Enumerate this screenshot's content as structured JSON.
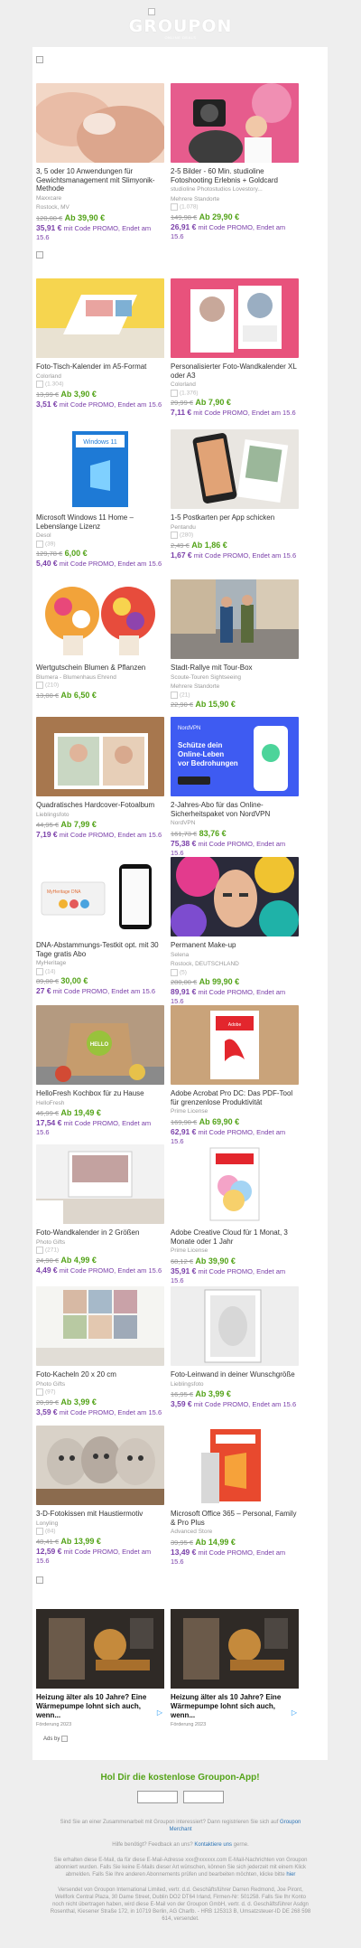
{
  "header": {
    "logo_text": "GROUPON",
    "logo_sub": "ONLINE DEALS"
  },
  "products": [
    {
      "title": "3, 5 oder 10 Anwendungen für Gewichtsmanagement mit Slimyonik-Methode",
      "meta1": "Maxxcare",
      "meta2": "Rostock, MV",
      "rating": "",
      "old": "120,00 €",
      "now": "Ab 39,90 €",
      "promo_price": "35,91 €",
      "promo_text": "mit Code PROMO, Endet am 15.6"
    },
    {
      "title": "2-5 Bilder - 60 Min. studioline Fotoshooting Erlebnis + Goldcard",
      "meta1": "studioline Photostudios Lovestory...",
      "meta2": "Mehrere Standorte",
      "rating": "(1.078)",
      "old": "149,98 €",
      "now": "Ab 29,90 €",
      "promo_price": "26,91 €",
      "promo_text": "mit Code PROMO, Endet am 15.6"
    },
    {
      "title": "Foto-Tisch-Kalender im A5-Format",
      "meta1": "Colorland",
      "meta2": "",
      "rating": "(1.304)",
      "old": "13,99 €",
      "now": "Ab 3,90 €",
      "promo_price": "3,51 €",
      "promo_text": "mit Code PROMO, Endet am 15.6"
    },
    {
      "title": "Personalisierter Foto-Wandkalender XL oder A3",
      "meta1": "Colorland",
      "meta2": "",
      "rating": "(1.376)",
      "old": "29,99 €",
      "now": "Ab 7,90 €",
      "promo_price": "7,11 €",
      "promo_text": "mit Code PROMO, Endet am 15.6"
    },
    {
      "title": "Microsoft Windows 11 Home – Lebenslange Lizenz",
      "meta1": "Desol",
      "meta2": "",
      "rating": "(39)",
      "old": "129,78 €",
      "now": "6,00 €",
      "promo_price": "5,40 €",
      "promo_text": "mit Code PROMO, Endet am 15.6"
    },
    {
      "title": "1-5 Postkarten per App schicken",
      "meta1": "Pentandu",
      "meta2": "",
      "rating": "(280)",
      "old": "2,49 €",
      "now": "Ab 1,86 €",
      "promo_price": "1,67 €",
      "promo_text": "mit Code PROMO, Endet am 15.6"
    },
    {
      "title": "Wertgutschein Blumen & Pflanzen",
      "meta1": "Blumera - Blumenhaus Ehrend",
      "meta2": "",
      "rating": "(210)",
      "old": "13,00 €",
      "now": "Ab 6,50 €",
      "promo_price": "",
      "promo_text": ""
    },
    {
      "title": "Stadt-Rallye mit Tour-Box",
      "meta1": "Scoute-Touren Sightseeing",
      "meta2": "Mehrere Standorte",
      "rating": "(21)",
      "old": "22,90 €",
      "now": "Ab 15,90 €",
      "promo_price": "",
      "promo_text": ""
    },
    {
      "title": "Quadratisches Hardcover-Fotoalbum",
      "meta1": "Lieblingsfoto",
      "meta2": "",
      "rating": "",
      "old": "44,95 €",
      "now": "Ab 7,99 €",
      "promo_price": "7,19 €",
      "promo_text": "mit Code PROMO, Endet am 15.6"
    },
    {
      "title": "2-Jahres-Abo für das Online-Sicherheitspaket von NordVPN",
      "meta1": "NordVPN",
      "meta2": "",
      "rating": "",
      "old": "161,73 €",
      "now": "83,76 €",
      "promo_price": "75,38 €",
      "promo_text": "mit Code PROMO, Endet am 15.6"
    },
    {
      "title": "DNA-Abstammungs-Testkit opt. mit 30 Tage gratis Abo",
      "meta1": "MyHeritage",
      "meta2": "",
      "rating": "(14)",
      "old": "89,00 €",
      "now": "30,00 €",
      "promo_price": "27 €",
      "promo_text": "mit Code PROMO, Endet am 15.6"
    },
    {
      "title": "Permanent Make-up",
      "meta1": "Selena",
      "meta2": "Rostock, DEUTSCHLAND",
      "rating": "(5)",
      "old": "280,00 €",
      "now": "Ab 99,90 €",
      "promo_price": "89,91 €",
      "promo_text": "mit Code PROMO, Endet am 15.6"
    },
    {
      "title": "HelloFresh Kochbox für zu Hause",
      "meta1": "HelloFresh",
      "meta2": "",
      "rating": "",
      "old": "46,99 €",
      "now": "Ab 19,49 €",
      "promo_price": "17,54 €",
      "promo_text": "mit Code PROMO, Endet am 15.6"
    },
    {
      "title": "Adobe Acrobat Pro DC: Das PDF-Tool für grenzenlose Produktivität",
      "meta1": "Prime License",
      "meta2": "",
      "rating": "",
      "old": "169,90 €",
      "now": "Ab 69,90 €",
      "promo_price": "62,91 €",
      "promo_text": "mit Code PROMO, Endet am 15.6"
    },
    {
      "title": "Foto-Wandkalender in 2 Größen",
      "meta1": "Photo Gifts",
      "meta2": "",
      "rating": "(271)",
      "old": "24,90 €",
      "now": "Ab 4,99 €",
      "promo_price": "4,49 €",
      "promo_text": "mit Code PROMO, Endet am 15.6"
    },
    {
      "title": "Adobe Creative Cloud für 1 Monat, 3 Monate oder 1 Jahr",
      "meta1": "Prime License",
      "meta2": "",
      "rating": "",
      "old": "68,12 €",
      "now": "Ab 39,90 €",
      "promo_price": "35,91 €",
      "promo_text": "mit Code PROMO, Endet am 15.6"
    },
    {
      "title": "Foto-Kacheln 20 x 20 cm",
      "meta1": "Photo Gifts",
      "meta2": "",
      "rating": "(97)",
      "old": "20,99 €",
      "now": "Ab 3,99 €",
      "promo_price": "3,59 €",
      "promo_text": "mit Code PROMO, Endet am 15.6"
    },
    {
      "title": "Foto-Leinwand in deiner Wunschgröße",
      "meta1": "Lieblingsfoto",
      "meta2": "",
      "rating": "",
      "old": "16,95 €",
      "now": "Ab 3,99 €",
      "promo_price": "3,59 €",
      "promo_text": "mit Code PROMO, Endet am 15.6"
    },
    {
      "title": "3-D-Fotokissen mit Haustiermotiv",
      "meta1": "Lonyling",
      "meta2": "",
      "rating": "(84)",
      "old": "48,41 €",
      "now": "Ab 13,99 €",
      "promo_price": "12,59 €",
      "promo_text": "mit Code PROMO, Endet am 15.6"
    },
    {
      "title": "Microsoft Office 365 – Personal, Family & Pro Plus",
      "meta1": "Advanced Store",
      "meta2": "",
      "rating": "",
      "old": "39,95 €",
      "now": "Ab 14,99 €",
      "promo_price": "13,49 €",
      "promo_text": "mit Code PROMO, Endet am 15.6"
    }
  ],
  "ads": [
    {
      "title": "Heizung älter als 10 Jahre? Eine Wärmepumpe lohnt sich auch, wenn...",
      "meta": "Förderung 2023"
    },
    {
      "title": "Heizung älter als 10 Jahre? Eine Wärmepumpe lohnt sich auch, wenn...",
      "meta": "Förderung 2023"
    }
  ],
  "ads_label": "Ads by",
  "app": {
    "title": "Hol Dir die kostenlose Groupon-App!"
  },
  "footer": {
    "merchant_q": "Sind Sie an einer Zusammenarbeit mit Groupon interessiert? Dann registrieren Sie sich auf",
    "merchant_link": "Groupon Merchant",
    "help_pre": "Hilfe benötigt? Feedback an uns?",
    "help_link": "Kontaktiere uns",
    "help_post": "gerne.",
    "info": "Sie erhalten diese E-Mail, da für diese E-Mail-Adresse xxx@xxxxxx.com E-Mail-Nachrichten von Groupon abonniert wurden. Falls Sie keine E-Mails dieser Art wünschen, können Sie sich jederzeit mit einem Klick abmelden. Falls Sie Ihre anderen Abonnements prüfen und bearbeiten möchten, klicke bitte",
    "info_link": "hier",
    "legal": "Versendet von Groupon International Limited, vertr. d.d. Geschäftsführer Darren Redmond, Joe Piront, Wellfork Central Plaza, 30 Dame Street, Dublin DO2 DT64 Irland, Firmen-Nr: 501258. Falls Sie Ihr Konto noch nicht übertragen haben, wird diese E-Mail von der Groupon GmbH, vertr. d. d. Geschäftsführer Asdgn Rosenthal, Kiesener Straße 172, in 10719 Berlin, AG Charlb. - HRB 125313 B, Umsatzsteuer-ID DE 268 598 614, versendet."
  }
}
